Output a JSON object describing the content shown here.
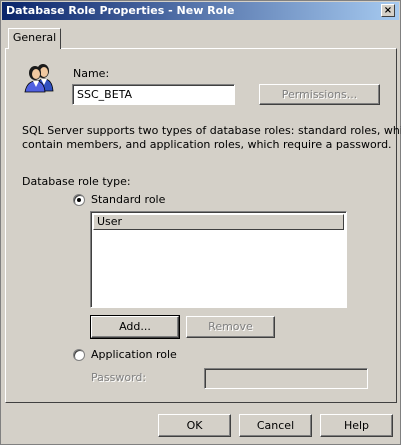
{
  "window": {
    "title": "Database Role Properties - New Role",
    "close_glyph": "×"
  },
  "tabs": [
    {
      "label": "General"
    }
  ],
  "icon": {
    "name": "database-role-icon"
  },
  "name_field": {
    "label": "Name:",
    "value": "SSC_BETA"
  },
  "permissions_button": {
    "label": "Permissions..."
  },
  "description": {
    "line1": "SQL Server supports two types of database roles: standard roles, which",
    "line2": "contain members, and application roles, which require a password."
  },
  "role_type": {
    "label": "Database role type:",
    "standard_label": "Standard role",
    "application_label": "Application role",
    "selected": "standard"
  },
  "members_list": {
    "column_header": "User",
    "rows": []
  },
  "add_button": {
    "label": "Add..."
  },
  "remove_button": {
    "label": "Remove"
  },
  "password_field": {
    "label": "Password:",
    "value": ""
  },
  "footer": {
    "ok": "OK",
    "cancel": "Cancel",
    "help": "Help"
  }
}
